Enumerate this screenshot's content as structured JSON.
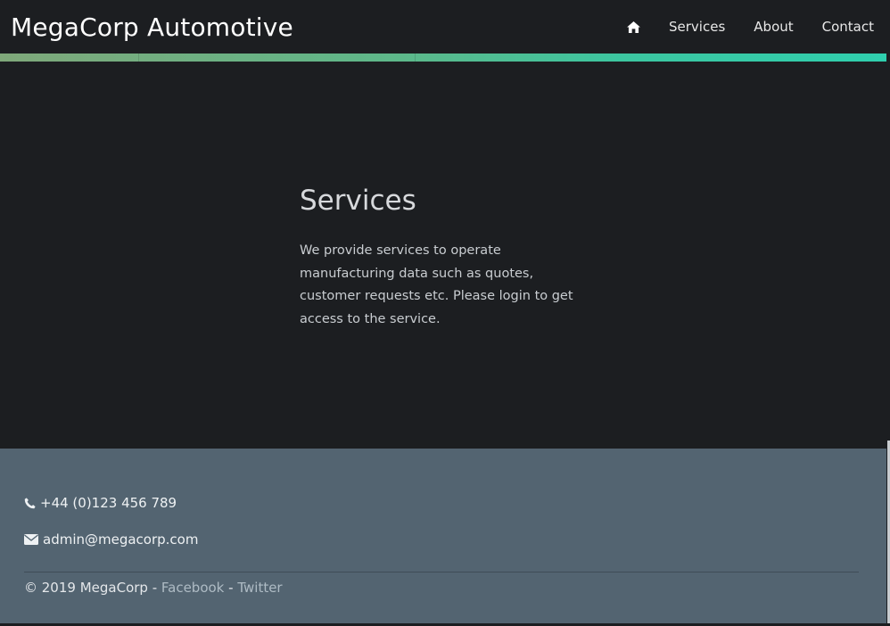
{
  "brand": "MegaCorp Automotive",
  "nav": {
    "home_icon": "home-icon",
    "items": [
      "Services",
      "About",
      "Contact"
    ]
  },
  "section": {
    "title": "Services",
    "text": "We provide services to operate manufacturing data such as quotes, customer requests etc. Please login to get access to the service."
  },
  "footer": {
    "phone_icon": "phone-icon",
    "phone": "+44 (0)123 456 789",
    "email_icon": "envelope-icon",
    "email": "admin@megacorp.com",
    "copyright": "© 2019 MegaCorp - ",
    "separator": " - ",
    "links": [
      "Facebook",
      "Twitter"
    ]
  },
  "colors": {
    "background": "#1c1e21",
    "footer": "#536471",
    "accent_start": "#7fa87a",
    "accent_end": "#2fcfae"
  }
}
